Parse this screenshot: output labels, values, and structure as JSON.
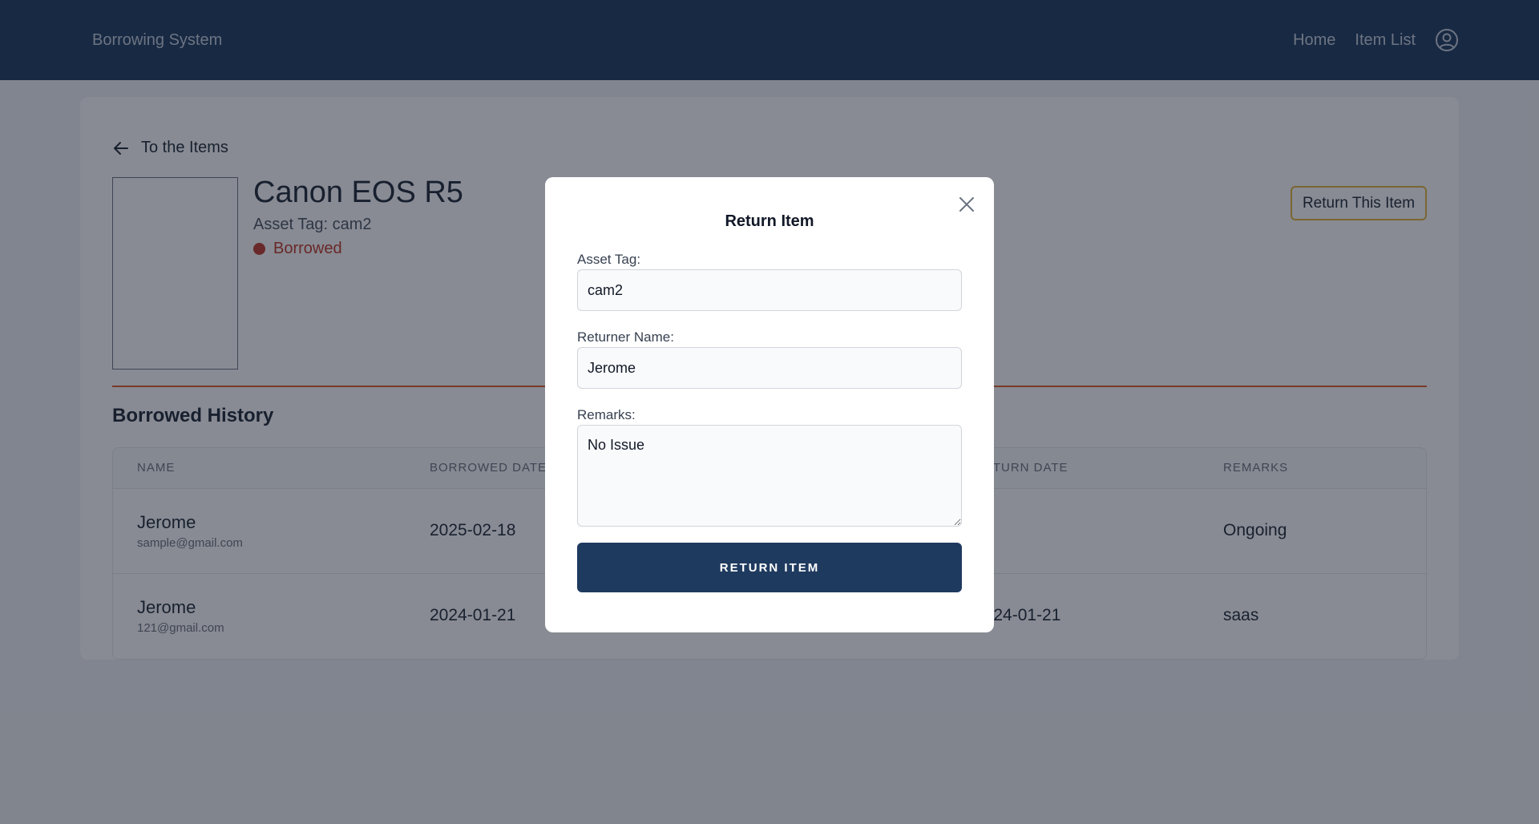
{
  "navbar": {
    "brand": "Borrowing System",
    "links": [
      "Home",
      "Item List"
    ],
    "user_icon": "user-circle-icon"
  },
  "page": {
    "back_label": "To the Items",
    "item_title": "Canon EOS R5",
    "asset_tag_line": "Asset Tag: cam2",
    "status": "Borrowed",
    "status_color": "#c0392b",
    "return_button": "Return This Item",
    "history_title": "Borrowed History"
  },
  "table": {
    "columns": [
      "NAME",
      "BORROWED DATE",
      "",
      "RETURN DATE",
      "REMARKS"
    ],
    "rows": [
      {
        "name": "Jerome",
        "email": "sample@gmail.com",
        "borrowed": "2025-02-18",
        "returned": "",
        "remarks": "Ongoing"
      },
      {
        "name": "Jerome",
        "email": "121@gmail.com",
        "borrowed": "2024-01-21",
        "returned": "2024-01-21",
        "remarks": "saas"
      }
    ]
  },
  "modal": {
    "title": "Return Item",
    "asset_tag_label": "Asset Tag:",
    "asset_tag_value": "cam2",
    "returner_label": "Returner Name:",
    "returner_value": "Jerome",
    "remarks_label": "Remarks:",
    "remarks_value": "No Issue",
    "submit_label": "RETURN ITEM"
  },
  "colors": {
    "navbar": "#1f3a5f",
    "accent_divider": "#e05a2b",
    "return_button_border": "#e2b43b"
  }
}
